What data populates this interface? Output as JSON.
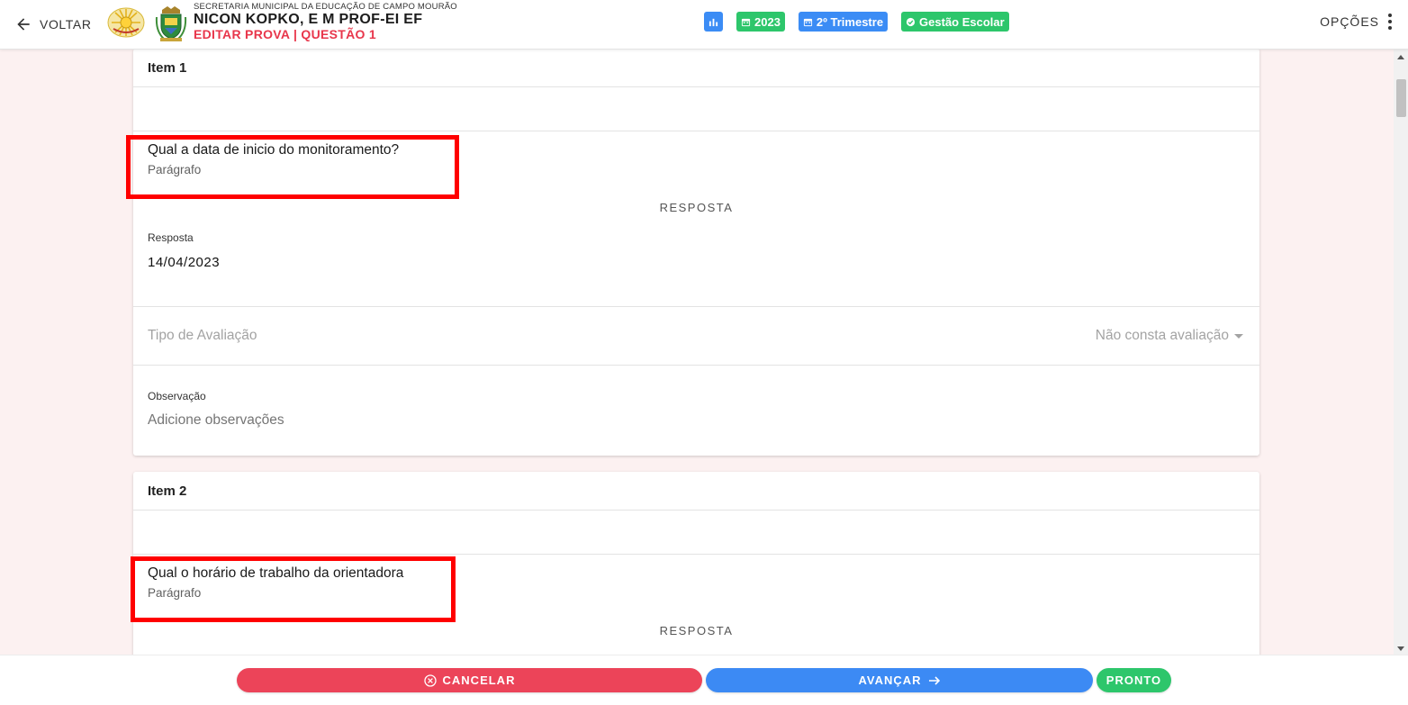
{
  "header": {
    "back_label": "VOLTAR",
    "secretaria": "SECRETARIA MUNICIPAL DA EDUCAÇÃO DE CAMPO MOURÃO",
    "school_name": "NICON KOPKO, E M PROF-EI EF",
    "edit_title": "EDITAR PROVA | QUESTÃO 1",
    "badges": {
      "year": "2023",
      "period": "2º Trimestre",
      "system": "Gestão Escolar"
    },
    "options_label": "OPÇÕES"
  },
  "items": [
    {
      "title": "Item 1",
      "question": "Qual a data de inicio do monitoramento?",
      "question_type": "Parágrafo",
      "answer_heading": "RESPOSTA",
      "answer_label": "Resposta",
      "answer_value": "14/04/2023",
      "eval_label": "Tipo de Avaliação",
      "eval_value": "Não consta avaliação",
      "obs_label": "Observação",
      "obs_placeholder": "Adicione observações"
    },
    {
      "title": "Item 2",
      "question": "Qual o horário de trabalho da orientadora",
      "question_type": "Parágrafo",
      "answer_heading": "RESPOSTA"
    }
  ],
  "footer": {
    "cancel_label": "CANCELAR",
    "next_label": "AVANÇAR",
    "done_label": "PRONTO"
  },
  "colors": {
    "accent_red": "#e8364b",
    "blue": "#3b8cf5",
    "green": "#2dc66b",
    "background_pink": "#fcf1f1",
    "highlight": "#ff0000"
  }
}
